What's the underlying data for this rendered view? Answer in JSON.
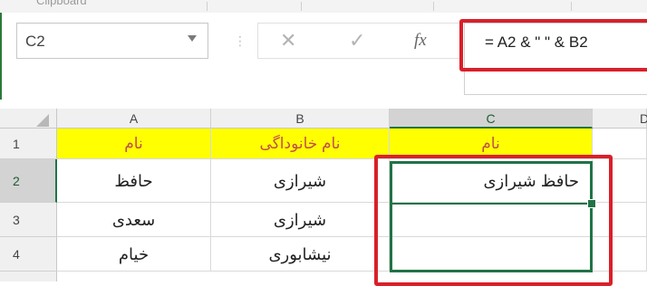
{
  "ribbon": {
    "group_label": "Clipboard"
  },
  "name_box": {
    "value": "C2"
  },
  "formula_bar": {
    "cancel_symbol": "✕",
    "enter_symbol": "✓",
    "fx_symbol": "fx",
    "formula": "= A2 & \" \" & B2"
  },
  "columns": [
    {
      "label": "A"
    },
    {
      "label": "B"
    },
    {
      "label": "C"
    },
    {
      "label": "D"
    }
  ],
  "rows": [
    {
      "number": "1",
      "cells": [
        "نام",
        "نام خانوداگی",
        "نام"
      ]
    },
    {
      "number": "2",
      "cells": [
        "حافظ",
        "شیرازی",
        "حافظ  شیرازی"
      ]
    },
    {
      "number": "3",
      "cells": [
        "سعدی",
        "شیرازی",
        ""
      ]
    },
    {
      "number": "4",
      "cells": [
        "خیام",
        "نیشابوری",
        ""
      ]
    }
  ],
  "colors": {
    "header_fill": "#ffff00",
    "header_text": "#c0504d",
    "selection": "#217346",
    "annotation_outline": "#d9202a"
  }
}
